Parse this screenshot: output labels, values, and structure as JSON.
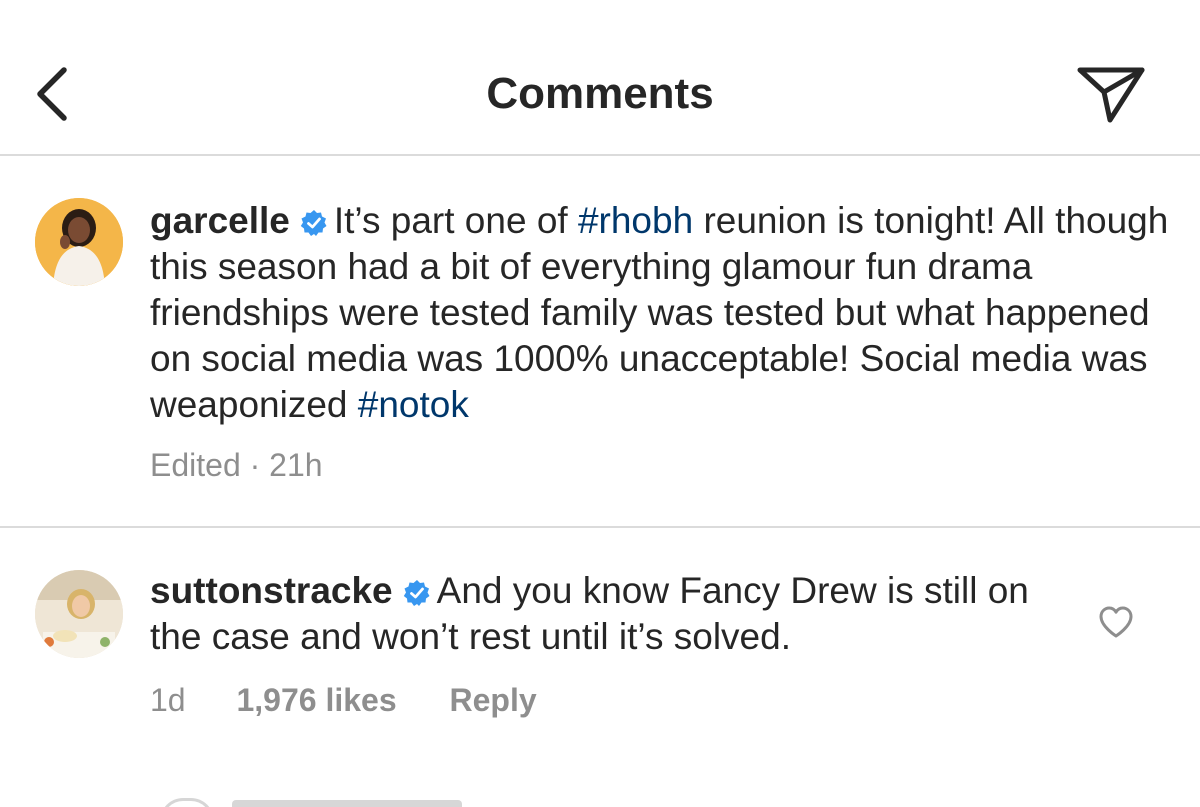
{
  "header": {
    "title": "Comments",
    "back_icon": "chevron-left-icon",
    "send_icon": "paper-plane-icon"
  },
  "caption": {
    "username": "garcelle",
    "verified": true,
    "text_parts": [
      {
        "text": "It’s part one of ",
        "type": "text"
      },
      {
        "text": "#rhobh",
        "type": "hashtag"
      },
      {
        "text": " reunion is tonight! All though this season had a bit of everything glamour fun drama friendships were tested family was tested but what happened on social media was 1000% unacceptable! Social media was weaponized ",
        "type": "text"
      },
      {
        "text": "#notok",
        "type": "hashtag"
      }
    ],
    "edited": "Edited",
    "separator": "·",
    "time": "21h"
  },
  "comments": [
    {
      "username": "suttonstracke",
      "verified": true,
      "text": "And you know Fancy Drew is still on the case and won’t rest until it’s solved.",
      "time": "1d",
      "likes": "1,976 likes",
      "reply_label": "Reply",
      "like_icon": "heart-outline-icon"
    }
  ],
  "colors": {
    "text": "#262626",
    "hashtag": "#00376b",
    "meta": "#8e8e8e",
    "verified": "#3897f0",
    "divider": "#dbdbdb"
  }
}
